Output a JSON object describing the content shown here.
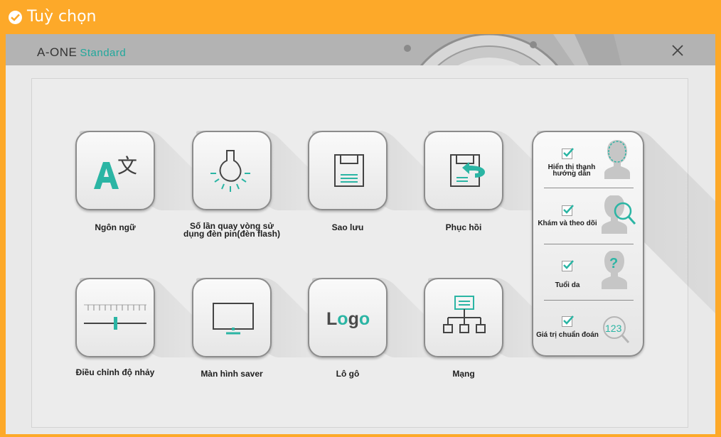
{
  "topbar": {
    "title": "Tuỳ chọn"
  },
  "window": {
    "brand_main": "A-ONE",
    "brand_sub": "Standard"
  },
  "tiles": [
    {
      "label": "Ngôn ngữ",
      "icon": "language-icon"
    },
    {
      "label": "Số lần quay vòng sử dụng đèn pin(đèn flash)",
      "icon": "lightbulb-icon"
    },
    {
      "label": "Sao lưu",
      "icon": "floppy-save-icon"
    },
    {
      "label": "Phục hồi",
      "icon": "restore-icon"
    },
    {
      "label": "Điều chỉnh độ nhảy",
      "icon": "sensitivity-slider-icon"
    },
    {
      "label": "Màn hình saver",
      "icon": "monitor-icon"
    },
    {
      "label": "Lô gô",
      "icon": "logo-icon",
      "icon_text": "Logo"
    },
    {
      "label": "Mạng",
      "icon": "network-icon"
    }
  ],
  "side_options": [
    {
      "label": "Hiển thị thanh hướng dẫn",
      "checked": true,
      "icon": "head-outline-icon"
    },
    {
      "label": "Khám và theo dõi",
      "checked": true,
      "icon": "head-search-icon"
    },
    {
      "label": "Tuổi da",
      "checked": true,
      "icon": "head-question-icon",
      "icon_text": "?"
    },
    {
      "label": "Giá trị chuẩn đoán",
      "checked": true,
      "icon": "numbers-magnifier-icon",
      "icon_text": "123"
    }
  ],
  "colors": {
    "accent": "#2bb5a4",
    "frame": "#fda929",
    "icon_gray": "#4a4a4a"
  }
}
